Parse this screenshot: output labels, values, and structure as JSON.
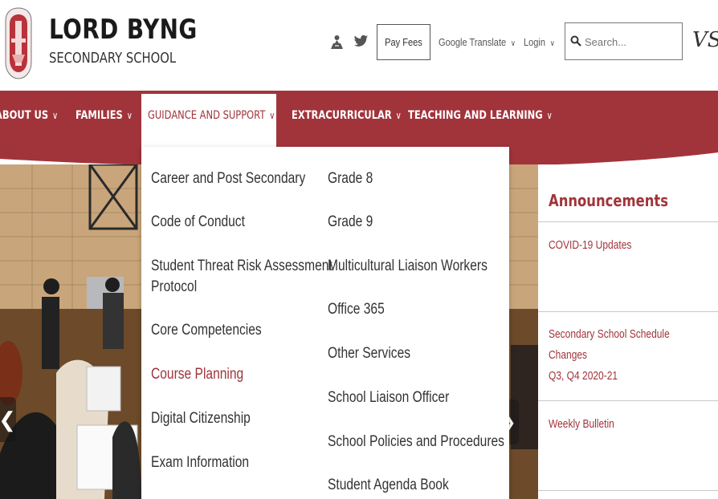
{
  "header": {
    "school_name": "LORD BYNG",
    "school_sub": "SECONDARY SCHOOL",
    "pay_fees": "Pay Fees",
    "google_translate": "Google Translate",
    "login": "Login",
    "search_placeholder": "Search...",
    "district_logo": "VSB"
  },
  "nav": {
    "items": [
      {
        "label": "ABOUT US"
      },
      {
        "label": "FAMILIES"
      },
      {
        "label": "GUIDANCE AND SUPPORT"
      },
      {
        "label": "EXTRACURRICULAR"
      },
      {
        "label": "TEACHING AND LEARNING"
      }
    ],
    "chevron": "∨"
  },
  "dropdown": {
    "left_column": [
      "Career and Post Secondary",
      "Code of Conduct",
      "Student Threat Risk Assessment",
      "Protocol",
      "Core Competencies",
      "Course Planning",
      "Digital Citizenship",
      "Exam Information"
    ],
    "right_column": [
      "Grade 8",
      "Grade 9",
      "Multicultural Liaison Workers",
      "Office 365",
      "Other Services",
      "School Liaison Officer",
      "School Policies and Procedures",
      "Student Agenda Book"
    ]
  },
  "announcements": {
    "title": "Announcements",
    "items": [
      "COVID-19 Updates",
      "Secondary School Schedule Changes",
      "Q3, Q4 2020-21",
      "Weekly Bulletin"
    ]
  },
  "hero": {
    "prev_glyph": "❮",
    "next_glyph": "❯"
  },
  "colors": {
    "brand": "#a1343b",
    "text": "#333333"
  }
}
